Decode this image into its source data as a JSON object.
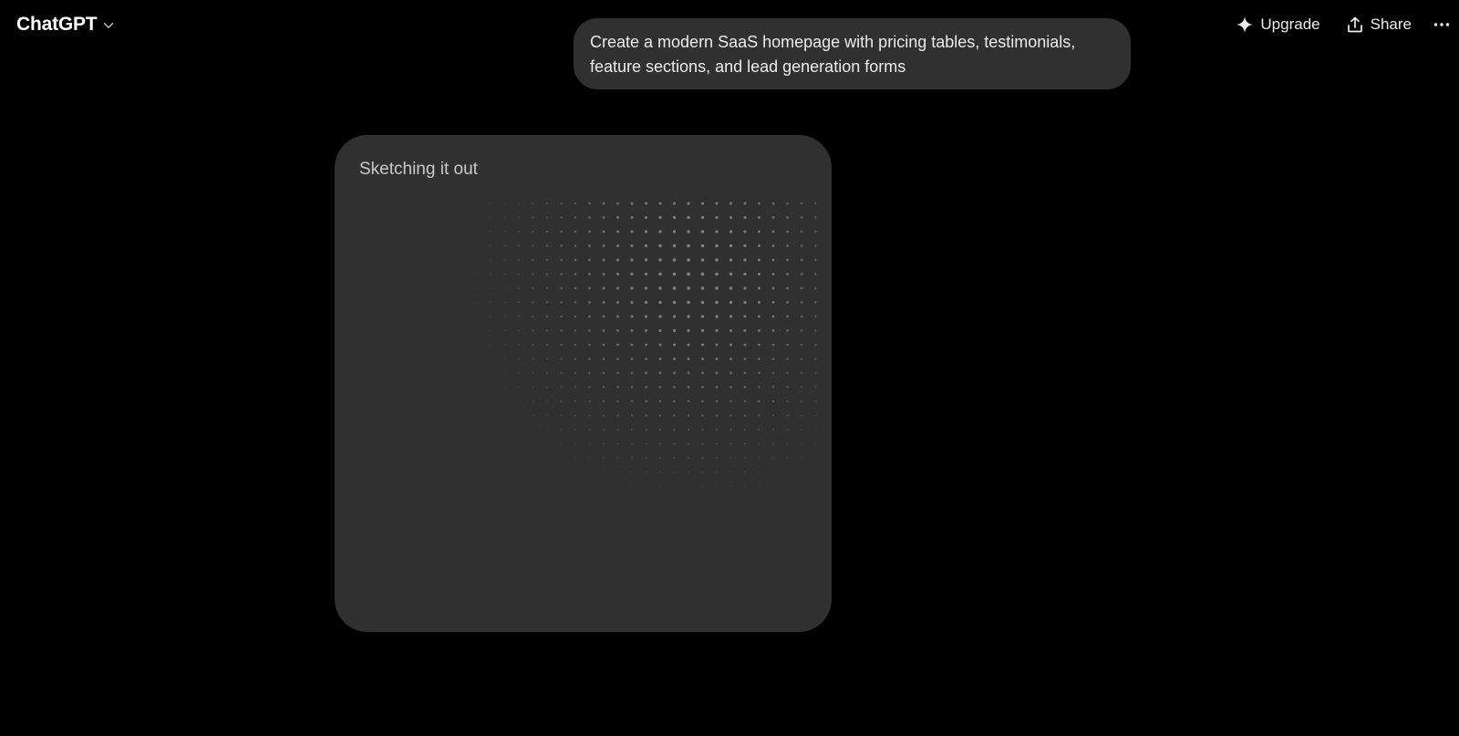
{
  "header": {
    "model_name": "ChatGPT",
    "model_icon": "chevron-down-icon",
    "upgrade_label": "Upgrade",
    "upgrade_icon": "sparkle-icon",
    "share_label": "Share",
    "share_icon": "share-upload-icon",
    "more_icon": "ellipsis-icon"
  },
  "conversation": {
    "user_message": "Create a modern SaaS homepage with pricing tables, testimonials, feature sections, and lead generation forms",
    "assistant_status": "Sketching it out",
    "status_visual": "dot-pattern"
  },
  "colors": {
    "background": "#000000",
    "bubble": "#303030",
    "card": "#303030",
    "text": "#ececec",
    "muted_text": "#c9c9c9",
    "dot": "#8e8e8e"
  }
}
